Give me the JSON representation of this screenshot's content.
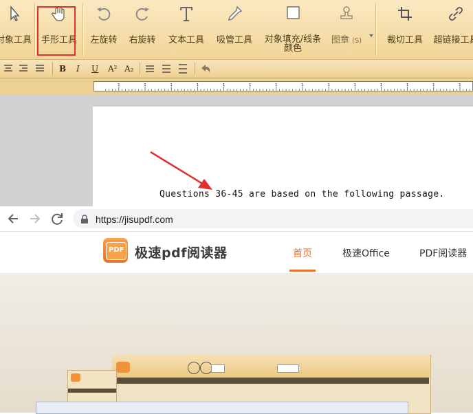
{
  "editor": {
    "tools": [
      {
        "label": "对象工具"
      },
      {
        "label": "手形工具"
      },
      {
        "label": "左旋转"
      },
      {
        "label": "右旋转"
      },
      {
        "label": "文本工具"
      },
      {
        "label": "吸管工具"
      },
      {
        "label": "对象填充/线条",
        "label2": "颜色"
      },
      {
        "label": "图章",
        "suffix": "(S)"
      },
      {
        "label": "裁切工具"
      },
      {
        "label": "超链接工具"
      }
    ],
    "format": {
      "bold": "B",
      "italic": "I",
      "underline": "U",
      "superscript": "A²",
      "subscript": "A₂"
    },
    "ruler_numbers": [
      "1",
      "1",
      "1",
      "1",
      "1",
      "1",
      "1",
      "1",
      "1",
      "1",
      "1",
      "1",
      "1",
      "1"
    ],
    "passage": "Questions 36-45 are based on the following passage."
  },
  "browser": {
    "url": "https://jisupdf.com",
    "brand": "极速pdf阅读器",
    "logo_text": "PDF",
    "nav": [
      "首页",
      "极速Office",
      "PDF阅读器"
    ]
  },
  "colors": {
    "accent": "#e8702b",
    "highlight": "#e03030"
  }
}
